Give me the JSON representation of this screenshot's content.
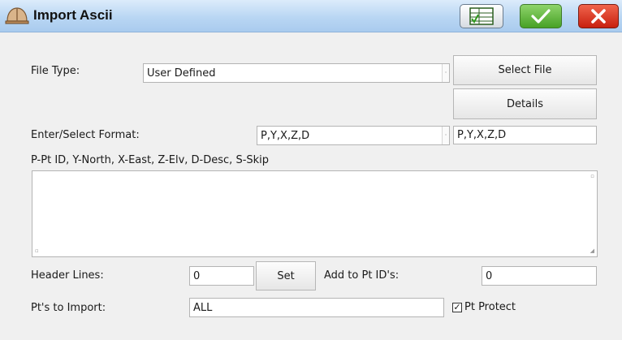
{
  "window": {
    "title": "Import Ascii"
  },
  "toolbar": {
    "ok_icon": "check-icon",
    "cancel_icon": "close-icon",
    "table_icon": "table-view-icon"
  },
  "form": {
    "file_type": {
      "label": "File Type:",
      "value": "User Defined"
    },
    "select_file_label": "Select File",
    "details_label": "Details",
    "format": {
      "label": "Enter/Select Format:",
      "dropdown_value": "P,Y,X,Z,D",
      "text_value": "P,Y,X,Z,D"
    },
    "legend": "P-Pt ID, Y-North, X-East, Z-Elv, D-Desc, S-Skip",
    "preview_text": "",
    "header_lines": {
      "label": "Header Lines:",
      "value": "0",
      "set_label": "Set"
    },
    "add_to_pt_ids": {
      "label": "Add to Pt ID's:",
      "value": "0"
    },
    "pts_to_import": {
      "label": "Pt's to Import:",
      "value": "ALL"
    },
    "pt_protect": {
      "label": "Pt Protect",
      "checked": true
    }
  }
}
